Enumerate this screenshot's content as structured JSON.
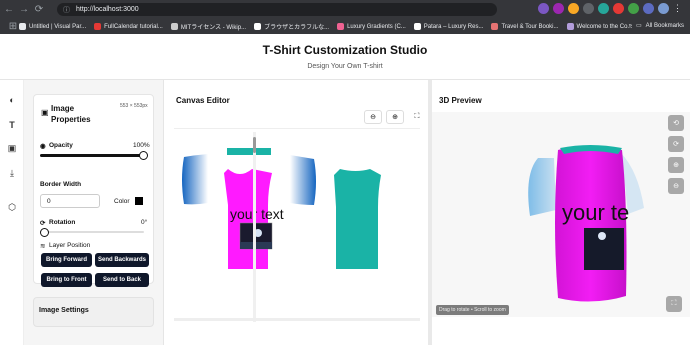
{
  "browser": {
    "url": "http://localhost:3000",
    "bookmarks": [
      {
        "label": "Untitled | Visual Par...",
        "color": "#e8eaed"
      },
      {
        "label": "FullCalendar tutorial...",
        "color": "#e53935"
      },
      {
        "label": "MITライセンス - Wikip...",
        "color": "#cccccc"
      },
      {
        "label": "ブラウザとカラフルな...",
        "color": "#cccccc"
      },
      {
        "label": "Luxury Gradients (C...",
        "color": "#f06292"
      },
      {
        "label": "Patara – Luxury Res...",
        "color": "#cccccc"
      },
      {
        "label": "Travel & Tour Booki...",
        "color": "#e57373"
      },
      {
        "label": "Welcome to the Co...",
        "color": "#b39ddb"
      }
    ],
    "all_bookmarks": "All Bookmarks"
  },
  "header": {
    "title": "T-Shirt Customization Studio",
    "subtitle": "Design Your Own T-shirt"
  },
  "properties": {
    "title": "Image Properties",
    "dims": "553 × 553px",
    "opacity_label": "Opacity",
    "opacity_value": "100%",
    "opacity_fraction": 1.0,
    "border_width_label": "Border Width",
    "border_width_value": "0",
    "color_label": "Color",
    "color_value": "#000000",
    "rotation_label": "Rotation",
    "rotation_value": "0°",
    "layer_label": "Layer Position",
    "buttons": {
      "bring_forward": "Bring Forward",
      "send_backwards": "Send Backwards",
      "bring_front": "Bring to Front",
      "send_back": "Send to Back"
    },
    "settings_title": "Image Settings"
  },
  "canvas": {
    "title": "Canvas Editor",
    "text": "your text",
    "shirt_color": "#ff1aff",
    "back_color": "#1ab3a6"
  },
  "preview": {
    "title": "3D Preview",
    "text": "your te",
    "hint": "Drag to rotate • Scroll to zoom"
  }
}
